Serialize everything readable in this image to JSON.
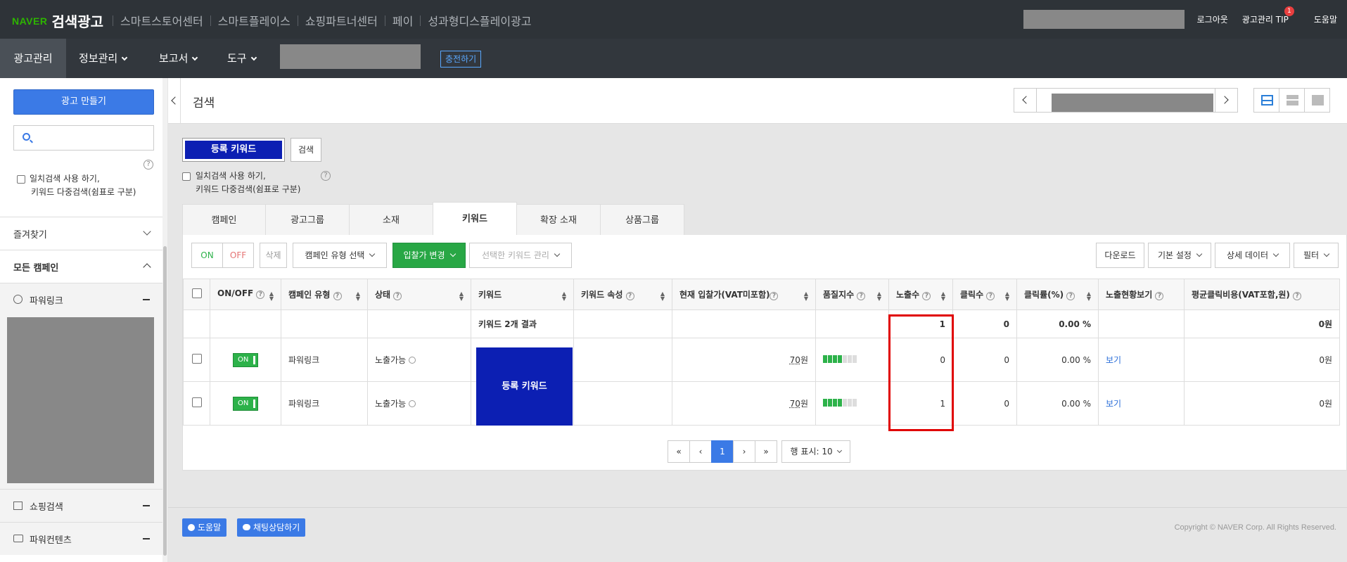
{
  "header": {
    "brand_logo": "NAVER",
    "brand_title": "검색광고",
    "top_links": [
      "스마트스토어센터",
      "스마트플레이스",
      "쇼핑파트너센터",
      "페이",
      "성과형디스플레이광고"
    ],
    "logout": "로그아웃",
    "tip": "광고관리 TIP",
    "tip_badge": "1",
    "help": "도움말"
  },
  "nav": {
    "items": [
      "광고관리",
      "정보관리",
      "보고서",
      "도구"
    ],
    "charge": "충전하기"
  },
  "sidebar": {
    "create_button": "광고 만들기",
    "help_mark": "?",
    "exact_check_line1": "일치검색 사용 하기,",
    "exact_check_line2": "키워드 다중검색(쉼표로 구분)",
    "favorites": "즐겨찾기",
    "all_campaigns": "모든 캠페인",
    "power_link": "파워링크",
    "shopping": "쇼핑검색",
    "power_contents": "파워컨텐츠"
  },
  "page": {
    "title": "검색"
  },
  "search": {
    "keyword_box": "등록 키워드",
    "search_button": "검색",
    "exact_check_line1": "일치검색 사용 하기,",
    "exact_check_line2": "키워드 다중검색(쉼표로 구분)"
  },
  "tabs": [
    "캠페인",
    "광고그룹",
    "소재",
    "키워드",
    "확장 소재",
    "상품그룹"
  ],
  "toolbar": {
    "on": "ON",
    "off": "OFF",
    "delete": "삭제",
    "campaign_type": "캠페인 유형 선택",
    "bid_change": "입찰가 변경",
    "manage": "선택한 키워드 관리",
    "download": "다운로드",
    "basic_settings": "기본 설정",
    "detail_data": "상세 데이터",
    "filter": "필터"
  },
  "table": {
    "headers": [
      "ON/OFF",
      "캠페인 유형",
      "상태",
      "키워드",
      "키워드 속성",
      "현재 입찰가(VAT미포함)",
      "품질지수",
      "노출수",
      "클릭수",
      "클릭률(%)",
      "노출현황보기",
      "평균클릭비용(VAT포함,원)"
    ],
    "summary": {
      "keyword": "키워드 2개 결과",
      "impressions": "1",
      "clicks": "0",
      "ctr": "0.00 %",
      "cpc": "0원"
    },
    "keyword_overlay": "등록 키워드",
    "rows": [
      {
        "onoff": "ON",
        "type": "파워링크",
        "status": "노출가능",
        "bid_num": "70",
        "bid_unit": "원",
        "quality": 4,
        "impressions": "0",
        "clicks": "0",
        "ctr": "0.00 %",
        "view": "보기",
        "cpc": "0원"
      },
      {
        "onoff": "ON",
        "type": "파워링크",
        "status": "노출가능",
        "bid_num": "70",
        "bid_unit": "원",
        "quality": 4,
        "impressions": "1",
        "clicks": "0",
        "ctr": "0.00 %",
        "view": "보기",
        "cpc": "0원"
      }
    ]
  },
  "pagination": {
    "first": "«",
    "prev": "‹",
    "current": "1",
    "next": "›",
    "last": "»",
    "rows_per_page": "행 표시: 10"
  },
  "footer": {
    "help": "도움말",
    "chat": "채팅상담하기",
    "copyright": "Copyright © NAVER Corp. All Rights Reserved."
  },
  "colors": {
    "accent": "#3b7ae6",
    "keyword_block": "#0c1fb3",
    "on_green": "#2db24a",
    "highlight_red": "#e00000"
  }
}
